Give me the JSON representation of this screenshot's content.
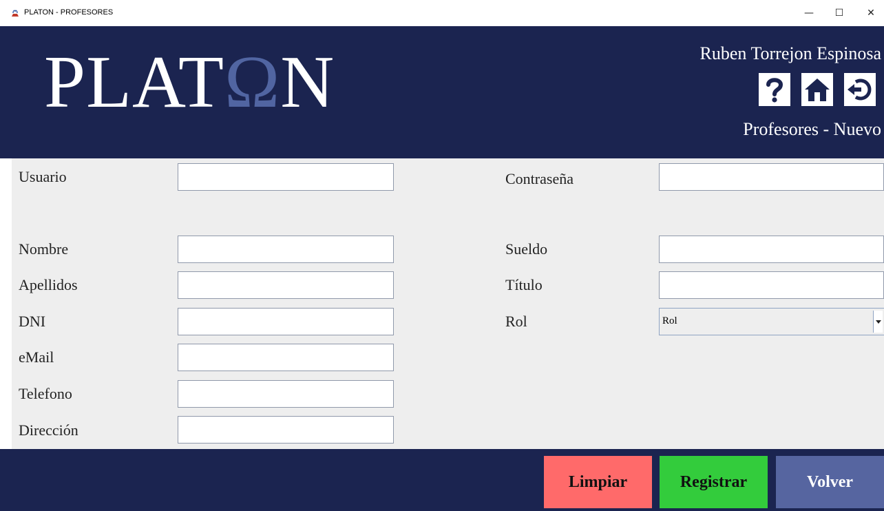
{
  "window": {
    "title": "PLATON - PROFESORES",
    "minimize": "—",
    "maximize": "☐",
    "close": "✕"
  },
  "header": {
    "logo": {
      "part1": "PLAT",
      "omega": "Ω",
      "part2": "N"
    },
    "user_name": "Ruben Torrejon Espinosa",
    "section_title": "Profesores - Nuevo",
    "icons": [
      "help-icon",
      "home-icon",
      "back-icon"
    ]
  },
  "form": {
    "left": [
      {
        "label": "Usuario",
        "value": ""
      },
      {
        "label": "Nombre",
        "value": ""
      },
      {
        "label": "Apellidos",
        "value": ""
      },
      {
        "label": "DNI",
        "value": ""
      },
      {
        "label": "eMail",
        "value": ""
      },
      {
        "label": "Telefono",
        "value": ""
      },
      {
        "label": "Dirección",
        "value": ""
      }
    ],
    "right": [
      {
        "label": "Contraseña",
        "value": ""
      },
      {
        "label": "Sueldo",
        "value": ""
      },
      {
        "label": "Título",
        "value": ""
      },
      {
        "label": "Rol",
        "value": "Rol"
      }
    ]
  },
  "footer": {
    "clear_label": "Limpiar",
    "register_label": "Registrar",
    "back_label": "Volver"
  },
  "colors": {
    "navy": "#1b2450",
    "omega": "#5165a2",
    "clear": "#ff6a6a",
    "register": "#33cc3c",
    "back": "#5665a0",
    "form_bg": "#eeeeee"
  }
}
